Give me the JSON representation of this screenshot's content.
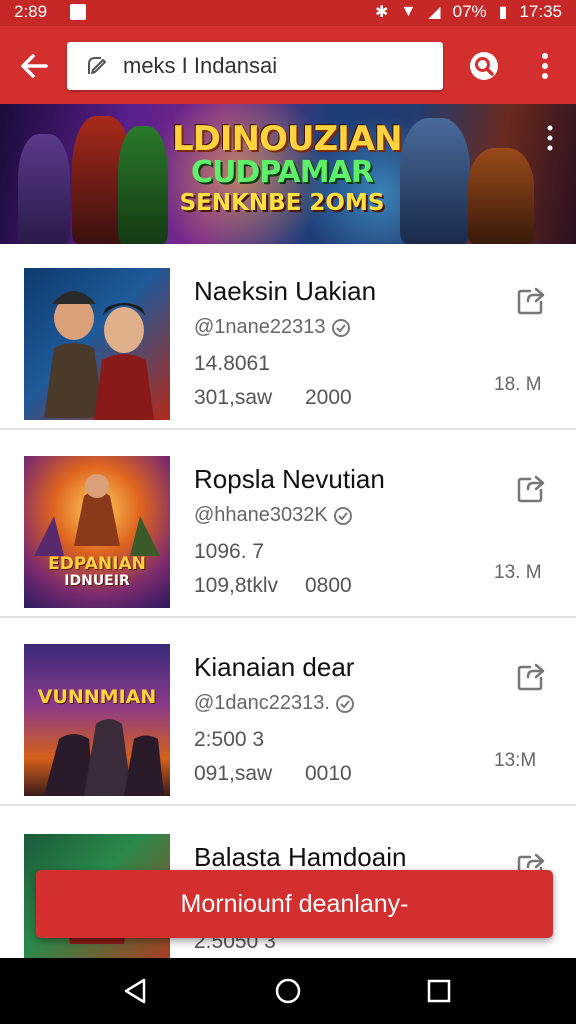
{
  "status_bar": {
    "time_left": "2:89",
    "battery_text": "07%",
    "time_right": "17:35"
  },
  "app_bar": {
    "back_icon": "arrow-left-icon",
    "search_query": "meks I Indansai",
    "search_icon": "search-icon",
    "menu_icon": "more-vert-icon"
  },
  "banner": {
    "line1": "LDINOUZIAN",
    "line2": "CUDPAMAR",
    "line3": "SENKNBE 2OMS"
  },
  "items": [
    {
      "name": "Naeksin Uakian",
      "handle": "@1nane22313",
      "stat1": "14.8061",
      "stat2a": "301,saw",
      "stat2b": "2000",
      "size": "18. M",
      "share_icon": "share-icon",
      "thumb_colors": [
        "#0e3a6e",
        "#b22a1a"
      ]
    },
    {
      "name": "Ropsla Nevutian",
      "handle": "@hhane3032K",
      "stat1": "1096. 7",
      "stat2a": "109,8tklv",
      "stat2b": "0800",
      "size": "13. M",
      "thumb_title_1": "EDPANIAN",
      "thumb_title_2": "IDNUEIR",
      "share_icon": "share-icon",
      "thumb_colors": [
        "#e0651e",
        "#3a1a6e"
      ]
    },
    {
      "name": "Kianaian dear",
      "handle": "@1danc22313.",
      "stat1": "2:500 3",
      "stat2a": "091,saw",
      "stat2b": "0010",
      "size": "13:M",
      "thumb_title_1": "VUNNMIAN",
      "share_icon": "share-icon",
      "thumb_colors": [
        "#5a2a8a",
        "#d4601a"
      ]
    },
    {
      "name": "Balasta Hamdoain",
      "handle": "",
      "stat1": "",
      "stat2a": "2.5050 3",
      "stat2b": "",
      "size": "",
      "share_icon": "share-icon",
      "thumb_colors": [
        "#1a5a3a",
        "#c0301a"
      ]
    }
  ],
  "snackbar": {
    "text": "Morniounf deanlany-"
  },
  "nav_bar": {
    "back_icon": "triangle-back-icon",
    "home_icon": "circle-home-icon",
    "recents_icon": "square-recents-icon"
  },
  "colors": {
    "primary": "#d32f2f",
    "status_bar": "#c62828",
    "divider": "#e0e0e0"
  }
}
